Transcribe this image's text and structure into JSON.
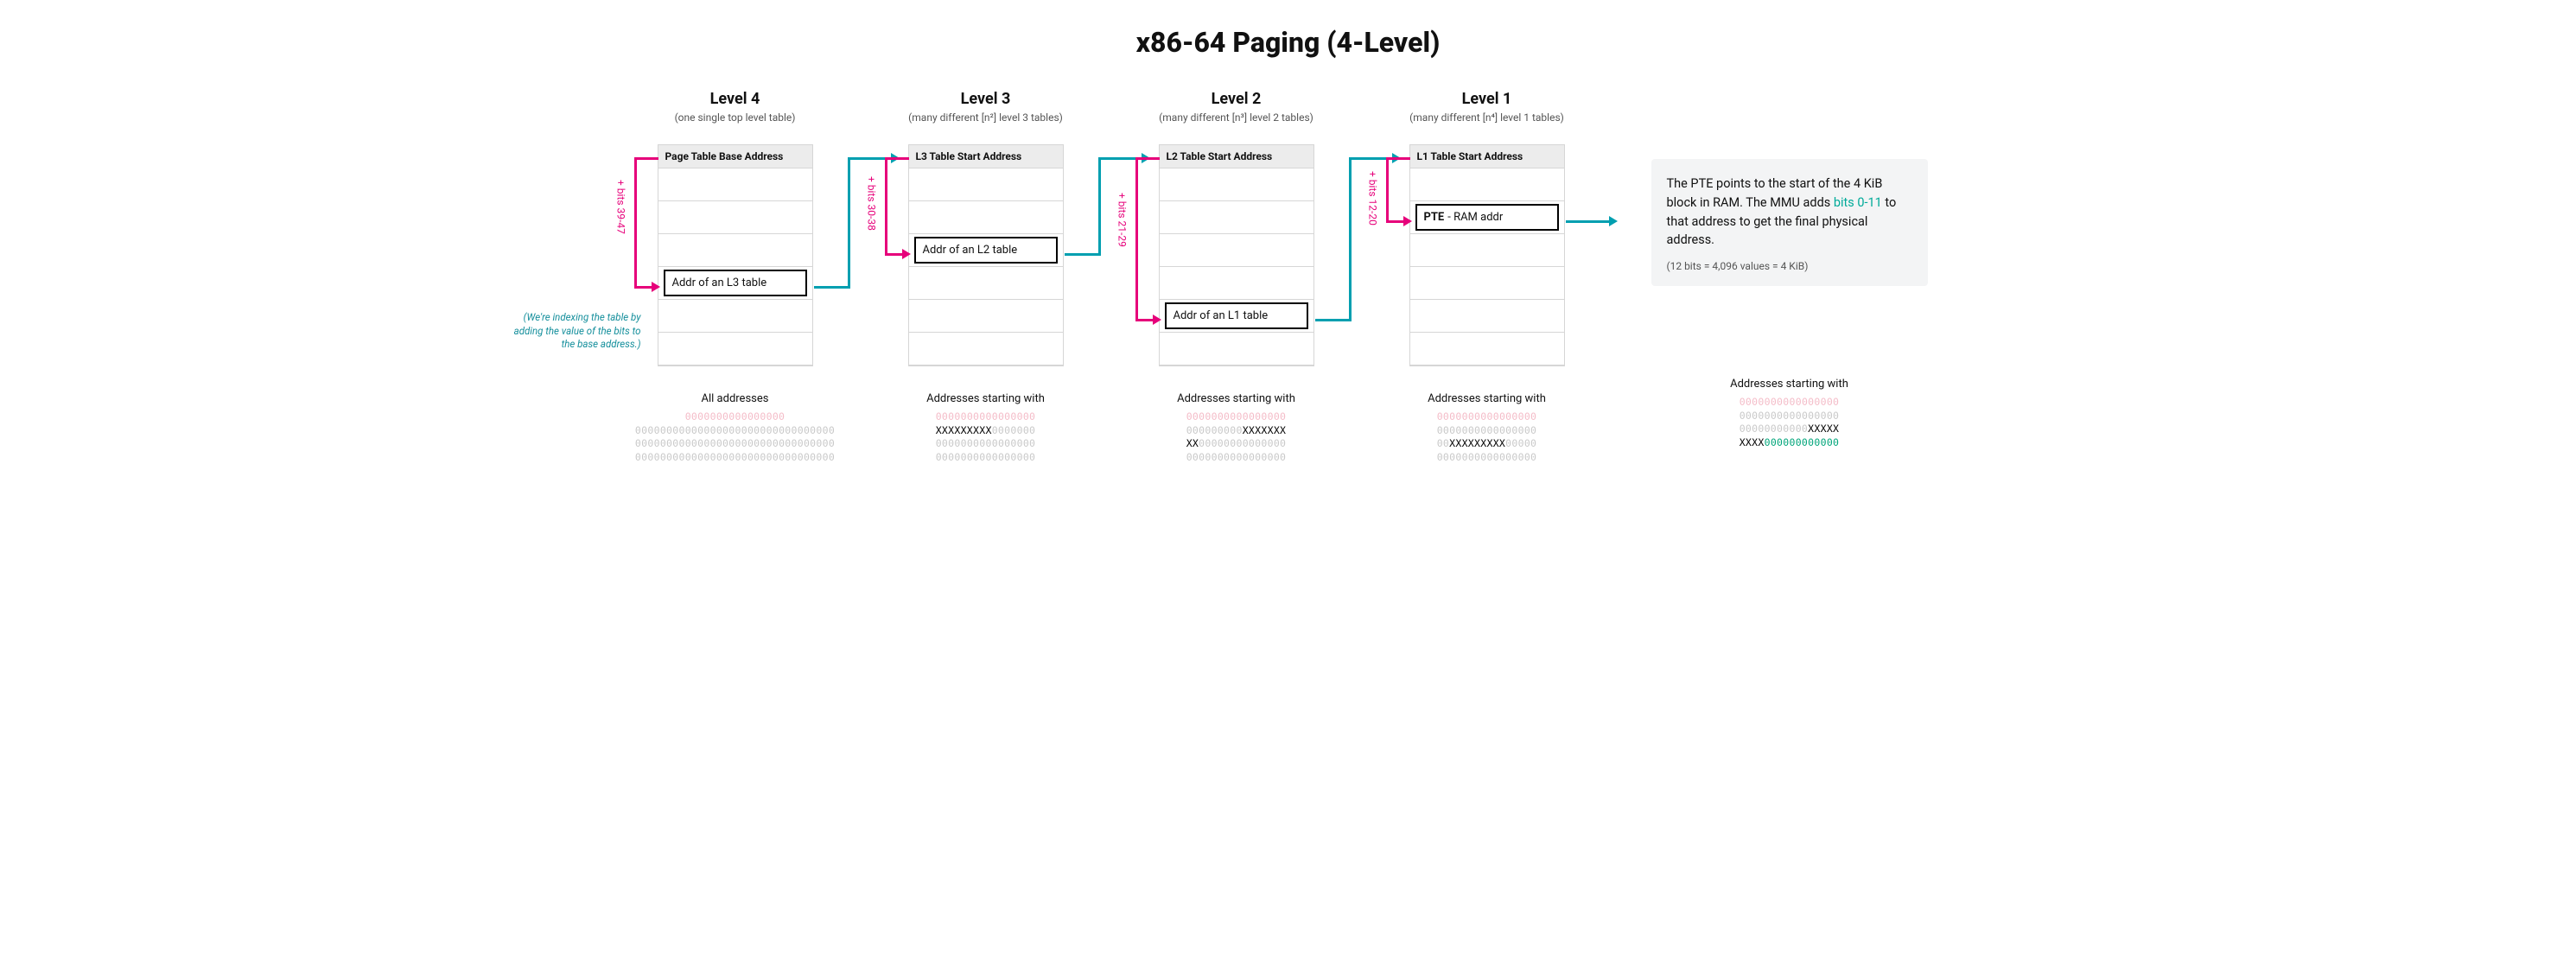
{
  "title": "x86-64 Paging (4-Level)",
  "levels": {
    "l4": {
      "title": "Level 4",
      "sub": "(one single top level table)",
      "tableHeader": "Page Table Base Address",
      "entry": "Addr of an L3 table",
      "bits": "+ bits 39-47",
      "indexNote": "(We're indexing the table by adding the value of the bits to the base address.)",
      "footerTitle": "All addresses"
    },
    "l3": {
      "title": "Level 3",
      "sub": "(many different [n²] level 3 tables)",
      "tableHeader": "L3 Table Start Address",
      "entry": "Addr of an L2 table",
      "bits": "+ bits 30-38",
      "footerTitle": "Addresses starting with"
    },
    "l2": {
      "title": "Level 2",
      "sub": "(many different [n³] level 2 tables)",
      "tableHeader": "L2 Table Start Address",
      "entry": "Addr of an L1 table",
      "bits": "+ bits 21-29",
      "footerTitle": "Addresses starting with"
    },
    "l1": {
      "title": "Level 1",
      "sub": "(many different [n⁴] level 1 tables)",
      "tableHeader": "L1 Table Start Address",
      "entryBold": "PTE",
      "entryRest": " - RAM addr",
      "bits": "+ bits 12-20",
      "footerTitle": "Addresses starting with"
    }
  },
  "info": {
    "line1a": "The PTE points to the start of the 4 KiB block in RAM. The MMU adds ",
    "accent": "bits 0-11",
    "line1b": " to that address to get the final physical address.",
    "small": "(12 bits = 4,096 values = 4 KiB)",
    "footerTitle": "Addresses starting with"
  },
  "footers": {
    "l4": {
      "r1": {
        "pink": "0000000000000000"
      },
      "r2": {
        "grey": "0000000000000000",
        "black": "",
        "grey2": "0000000000000000"
      },
      "r3": {
        "grey": "0000000000000000",
        "black": "",
        "grey2": "0000000000000000"
      },
      "r4": {
        "grey": "0000000000000000",
        "black": "",
        "grey2": "0000000000000000"
      }
    },
    "l3": {
      "r1": {
        "pink": "0000000000000000"
      },
      "r2": {
        "black": "XXXXXXXXX",
        "grey": "0000000"
      },
      "r3": {
        "grey": "0000000000000000"
      },
      "r4": {
        "grey": "0000000000000000"
      }
    },
    "l2": {
      "r1": {
        "pink": "0000000000000000"
      },
      "r2": {
        "grey": "000000000",
        "black": "XXXXXXX"
      },
      "r3": {
        "black": "XX",
        "grey": "00000000000000"
      },
      "r4": {
        "grey": "0000000000000000"
      }
    },
    "l1": {
      "r1": {
        "pink": "0000000000000000"
      },
      "r2": {
        "grey": "0000000000000000"
      },
      "r3": {
        "grey": "00",
        "black": "XXXXXXXXX",
        "grey2": "00000"
      },
      "r4": {
        "grey": "0000000000000000"
      }
    },
    "info": {
      "r1": {
        "pink": "0000000000000000"
      },
      "r2": {
        "grey": "0000000000000000"
      },
      "r3": {
        "grey": "00000000000",
        "black": "XXXXX"
      },
      "r4": {
        "black": "XXXX",
        "green": "000000000000"
      }
    }
  }
}
